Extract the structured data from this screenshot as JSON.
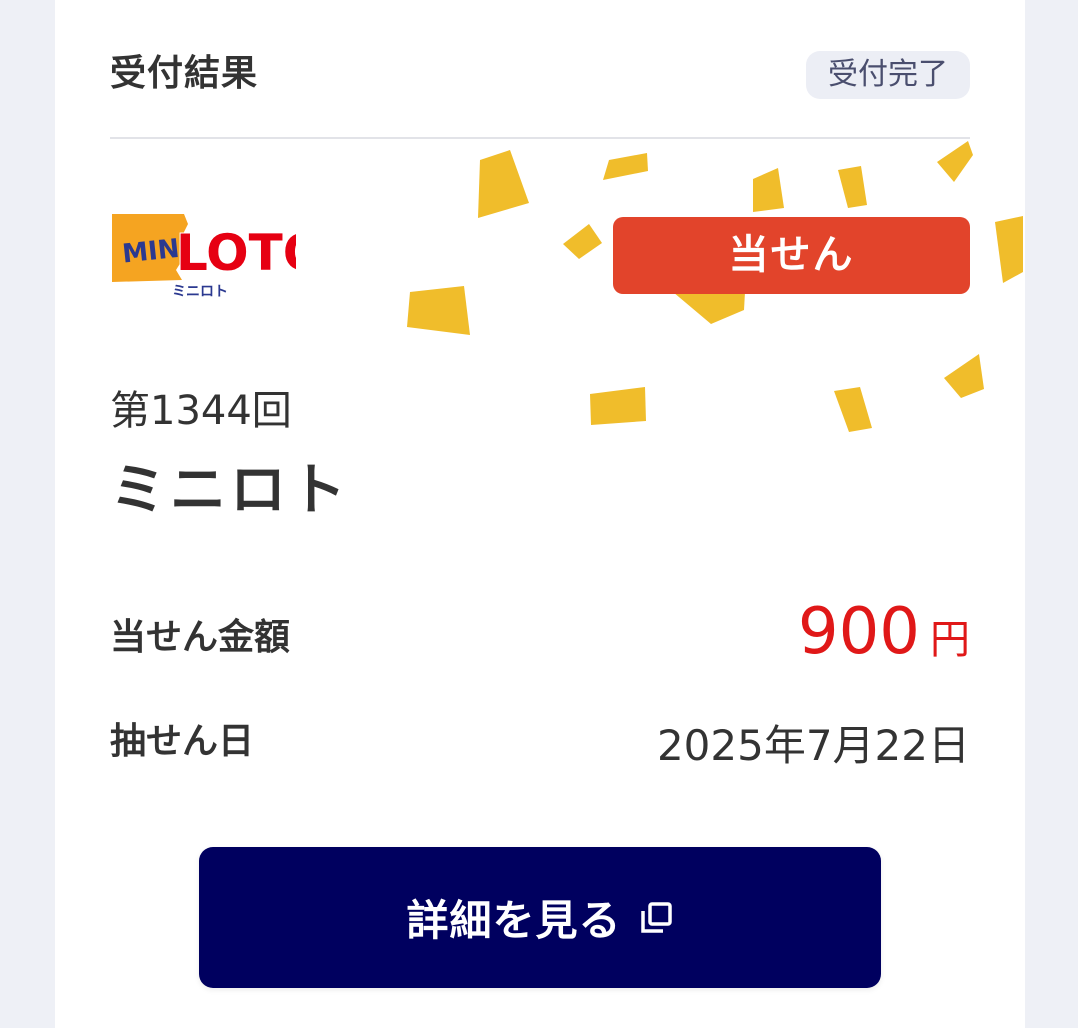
{
  "header": {
    "title": "受付結果",
    "status": "受付完了"
  },
  "ticket": {
    "logo_text": "MINI LOTO",
    "logo_subtext": "ミニロト",
    "result_badge": "当せん",
    "draw_number": "第1344回",
    "game_name": "ミニロト",
    "prize_label": "当せん金額",
    "prize_amount": "900",
    "prize_unit": "円",
    "draw_date_label": "抽せん日",
    "draw_date": "2025年7月22日"
  },
  "actions": {
    "details_label": "詳細を見る",
    "details_icon": "open-in-new-window-icon"
  },
  "colors": {
    "badge": "#e2442b",
    "button": "#00005f",
    "prize": "#e01818",
    "confetti": "#f0bd2b"
  }
}
